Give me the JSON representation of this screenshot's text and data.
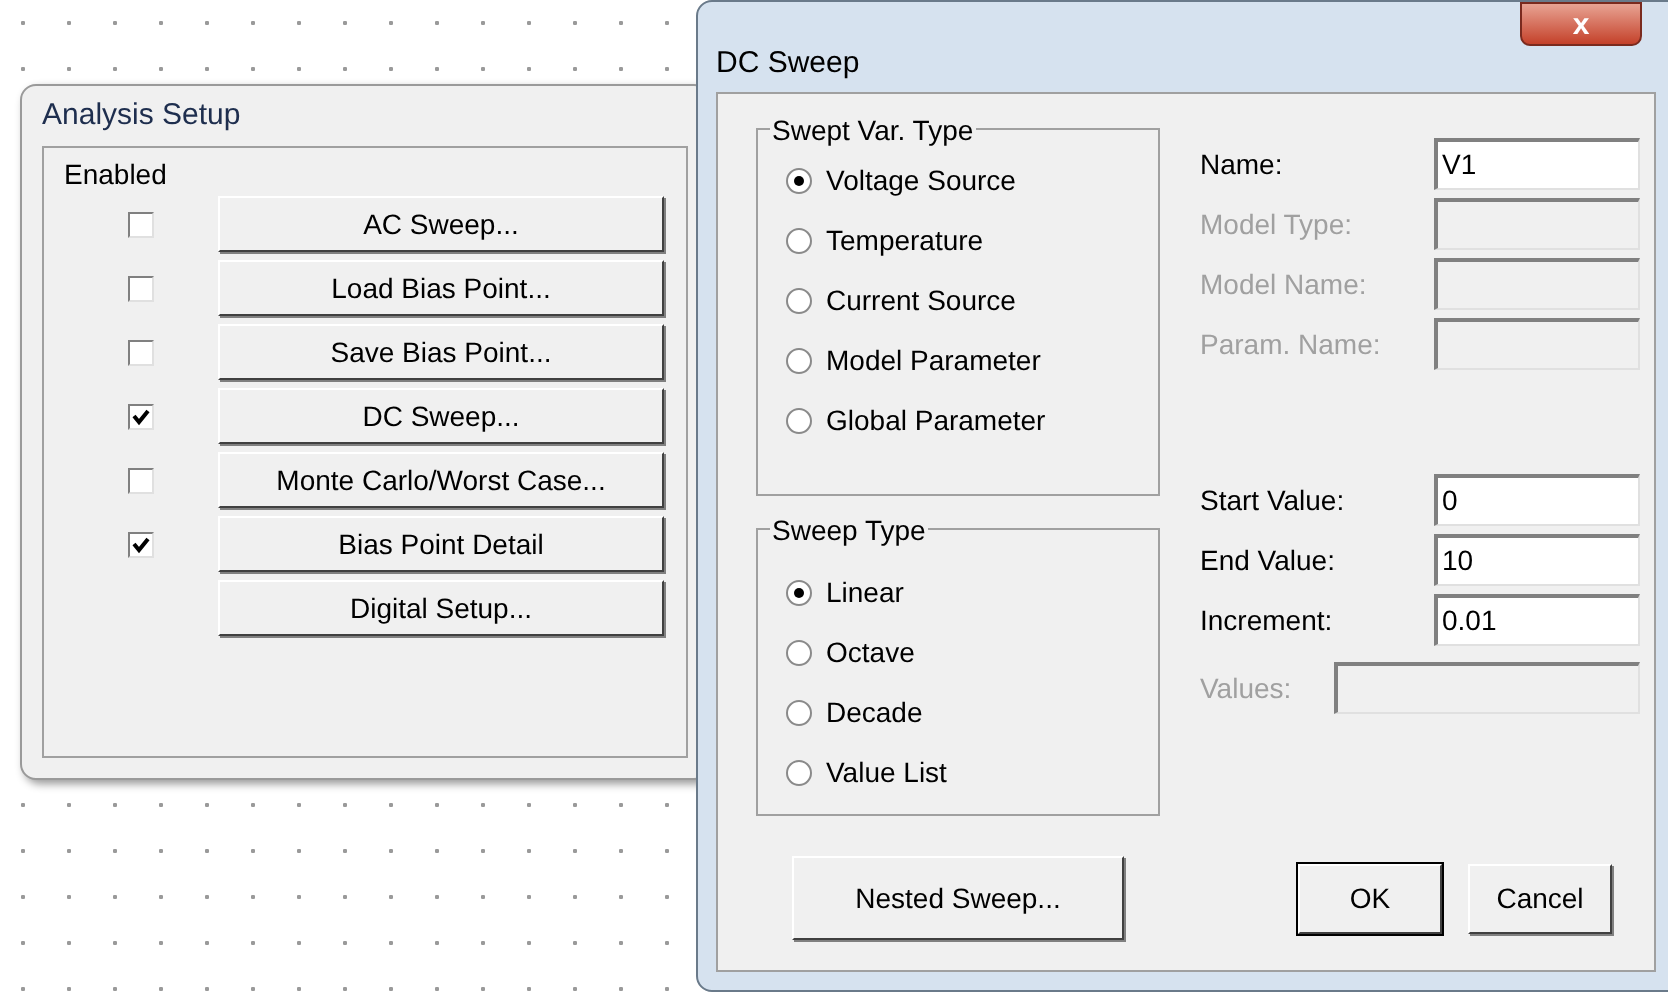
{
  "analysis_setup": {
    "title": "Analysis Setup",
    "column_header": "Enabled",
    "rows": [
      {
        "label": "AC Sweep...",
        "checked": false
      },
      {
        "label": "Load Bias Point...",
        "checked": false
      },
      {
        "label": "Save Bias Point...",
        "checked": false
      },
      {
        "label": "DC Sweep...",
        "checked": true
      },
      {
        "label": "Monte Carlo/Worst Case...",
        "checked": false
      },
      {
        "label": "Bias Point Detail",
        "checked": true
      },
      {
        "label": "Digital Setup...",
        "checked": null
      }
    ]
  },
  "dc_sweep": {
    "title": "DC Sweep",
    "close": "x",
    "swept_var_type": {
      "title": "Swept Var. Type",
      "options": [
        {
          "label": "Voltage Source",
          "selected": true
        },
        {
          "label": "Temperature",
          "selected": false
        },
        {
          "label": "Current Source",
          "selected": false
        },
        {
          "label": "Model Parameter",
          "selected": false
        },
        {
          "label": "Global Parameter",
          "selected": false
        }
      ]
    },
    "name_fields": [
      {
        "label": "Name:",
        "value": "V1",
        "disabled": false
      },
      {
        "label": "Model Type:",
        "disabled": true
      },
      {
        "label": "Model Name:",
        "disabled": true
      },
      {
        "label": "Param. Name:",
        "disabled": true
      }
    ],
    "sweep_type": {
      "title": "Sweep Type",
      "options": [
        {
          "label": "Linear",
          "selected": true
        },
        {
          "label": "Octave",
          "selected": false
        },
        {
          "label": "Decade",
          "selected": false
        },
        {
          "label": "Value List",
          "selected": false
        }
      ]
    },
    "value_fields": [
      {
        "label": "Start Value:",
        "value": "0",
        "disabled": false
      },
      {
        "label": "End Value:",
        "value": "10",
        "disabled": false
      },
      {
        "label": "Increment:",
        "value": "0.01",
        "disabled": false
      }
    ],
    "values_field": {
      "label": "Values:",
      "disabled": true
    },
    "buttons": [
      "Nested Sweep...",
      "OK",
      "Cancel"
    ]
  }
}
